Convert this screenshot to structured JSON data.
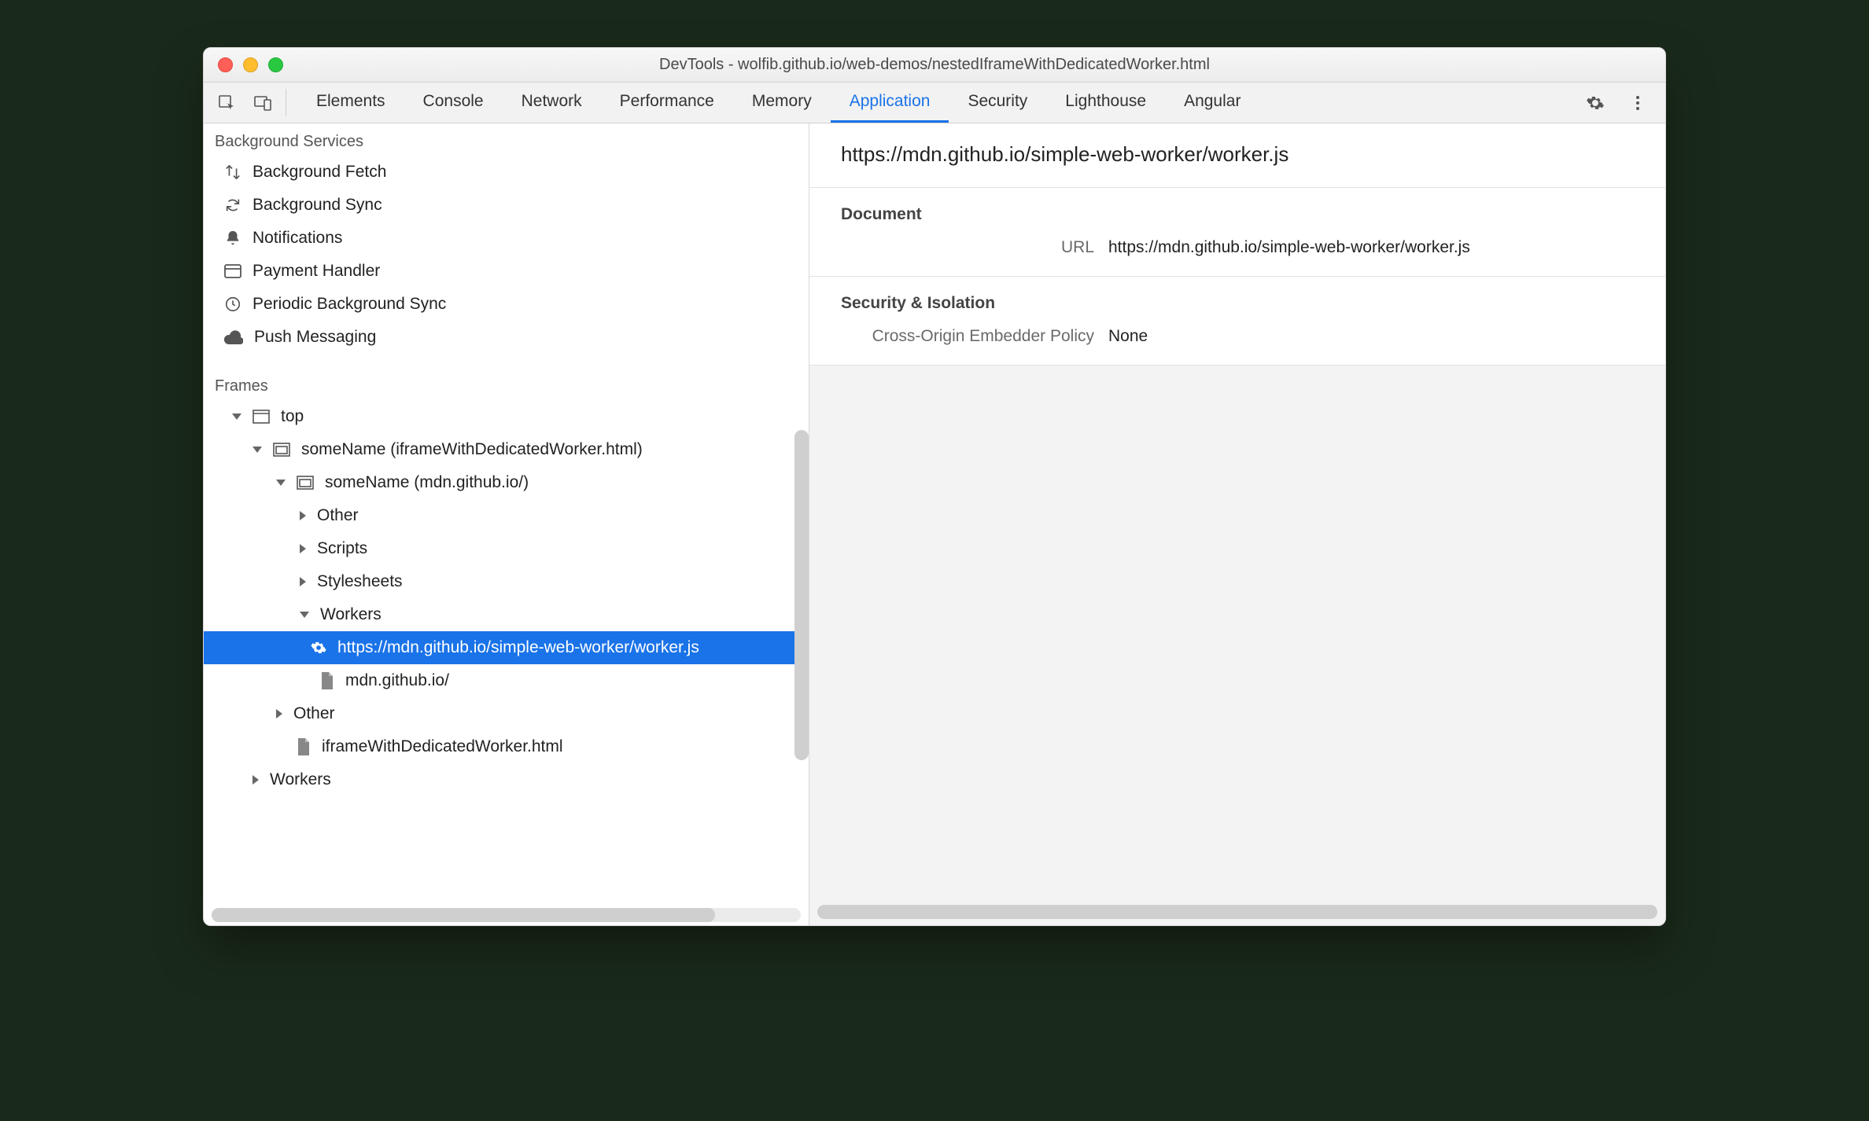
{
  "window": {
    "title": "DevTools - wolfib.github.io/web-demos/nestedIframeWithDedicatedWorker.html"
  },
  "tabs": {
    "items": [
      "Elements",
      "Console",
      "Network",
      "Performance",
      "Memory",
      "Application",
      "Security",
      "Lighthouse",
      "Angular"
    ],
    "activeIndex": 5
  },
  "sidebar": {
    "bg_title": "Background Services",
    "bg_items": [
      {
        "icon": "swap-vert-icon",
        "label": "Background Fetch"
      },
      {
        "icon": "refresh-icon",
        "label": "Background Sync"
      },
      {
        "icon": "bell-icon",
        "label": "Notifications"
      },
      {
        "icon": "card-icon",
        "label": "Payment Handler"
      },
      {
        "icon": "clock-icon",
        "label": "Periodic Background Sync"
      },
      {
        "icon": "cloud-icon",
        "label": "Push Messaging"
      }
    ],
    "frames_title": "Frames",
    "tree": {
      "top": "top",
      "child1": "someName (iframeWithDedicatedWorker.html)",
      "child2": "someName (mdn.github.io/)",
      "other": "Other",
      "scripts": "Scripts",
      "stylesheets": "Stylesheets",
      "workers": "Workers",
      "worker_item": "https://mdn.github.io/simple-web-worker/worker.js",
      "doc_item": "mdn.github.io/",
      "other2": "Other",
      "iframe_doc": "iframeWithDedicatedWorker.html",
      "workers2": "Workers"
    }
  },
  "detail": {
    "title": "https://mdn.github.io/simple-web-worker/worker.js",
    "groups": [
      {
        "heading": "Document",
        "rows": [
          {
            "k": "URL",
            "v": "https://mdn.github.io/simple-web-worker/worker.js"
          }
        ]
      },
      {
        "heading": "Security & Isolation",
        "rows": [
          {
            "k": "Cross-Origin Embedder Policy",
            "v": "None"
          }
        ]
      }
    ]
  }
}
